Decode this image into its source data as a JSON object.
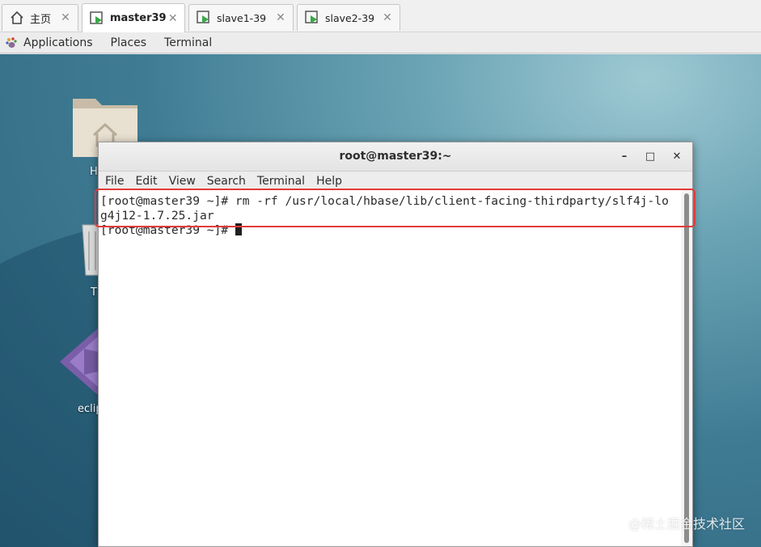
{
  "vm_tabs": [
    {
      "label": "主页",
      "icon": "home-icon"
    },
    {
      "label": "master39",
      "icon": "vm-icon",
      "active": true
    },
    {
      "label": "slave1-39",
      "icon": "vm-icon"
    },
    {
      "label": "slave2-39",
      "icon": "vm-icon"
    }
  ],
  "tab_close_glyph": "✕",
  "gnome_bar": {
    "applications": "Applications",
    "places": "Places",
    "terminal": "Terminal"
  },
  "desktop_icons": [
    {
      "label": "H",
      "icon": "home-folder-icon"
    },
    {
      "label": "T",
      "icon": "trash-icon"
    },
    {
      "label": "eclip",
      "icon": "eclipse-icon"
    }
  ],
  "terminal": {
    "title": "root@master39:~",
    "minimize": "–",
    "maximize": "□",
    "close": "✕",
    "menu": [
      "File",
      "Edit",
      "View",
      "Search",
      "Terminal",
      "Help"
    ],
    "lines": [
      "[root@master39 ~]# rm -rf /usr/local/hbase/lib/client-facing-thirdparty/slf4j-lo",
      "g4j12-1.7.25.jar",
      "[root@master39 ~]# "
    ]
  },
  "watermark": "@稀土掘金技术社区",
  "colors": {
    "highlight": "#e33a3a",
    "vm_icon_green": "#3aa84a"
  }
}
